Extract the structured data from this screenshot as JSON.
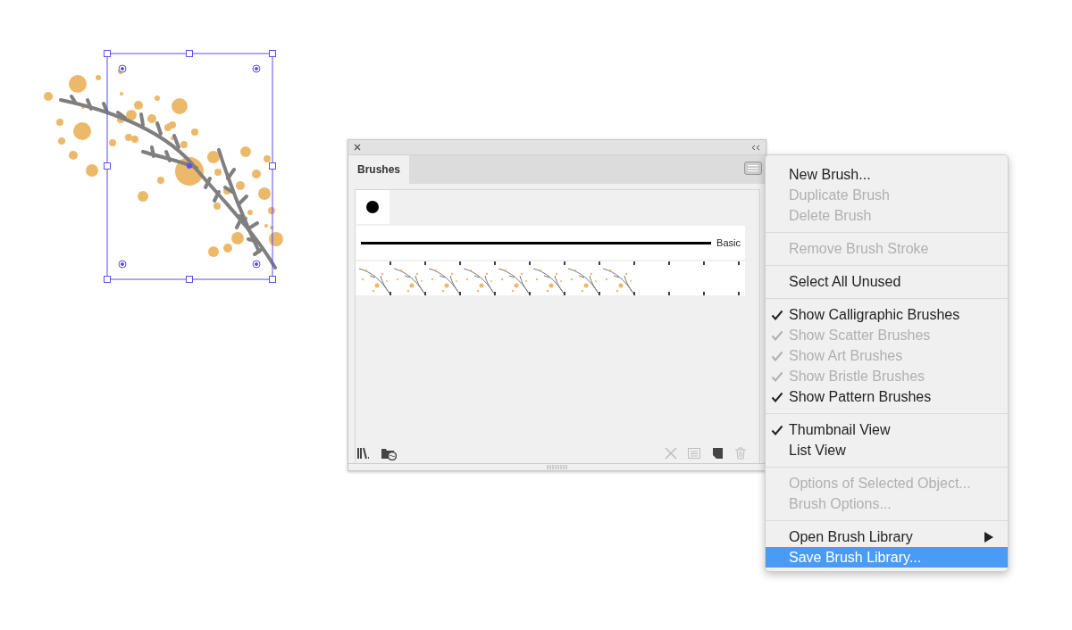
{
  "panel": {
    "tabs": [
      {
        "label": "Brushes",
        "selected": true
      }
    ],
    "brush_rows": [
      {
        "kind": "calligraphic"
      },
      {
        "kind": "stroke",
        "label": "Basic"
      },
      {
        "kind": "pattern"
      }
    ],
    "toolbar": [
      {
        "kind": "libraries",
        "disabled": false
      },
      {
        "kind": "cloud-library",
        "disabled": false
      },
      {
        "kind": "remove-stroke",
        "disabled": true
      },
      {
        "kind": "options",
        "disabled": true
      },
      {
        "kind": "new",
        "disabled": false
      },
      {
        "kind": "delete",
        "disabled": true
      }
    ]
  },
  "menu": {
    "sections": [
      [
        {
          "label": "New Brush...",
          "disabled": false,
          "selected": false
        },
        {
          "label": "Duplicate Brush",
          "disabled": true,
          "selected": false
        },
        {
          "label": "Delete Brush",
          "disabled": true,
          "selected": false
        }
      ],
      [
        {
          "label": "Remove Brush Stroke",
          "disabled": true,
          "selected": false
        }
      ],
      [
        {
          "label": "Select All Unused",
          "disabled": false,
          "selected": false
        }
      ],
      [
        {
          "label": "Show Calligraphic Brushes",
          "disabled": false,
          "checked": true,
          "selected": false
        },
        {
          "label": "Show Scatter Brushes",
          "disabled": true,
          "checked": true,
          "selected": false
        },
        {
          "label": "Show Art Brushes",
          "disabled": true,
          "checked": true,
          "selected": false
        },
        {
          "label": "Show Bristle Brushes",
          "disabled": true,
          "checked": true,
          "selected": false
        },
        {
          "label": "Show Pattern Brushes",
          "disabled": false,
          "checked": true,
          "selected": false
        }
      ],
      [
        {
          "label": "Thumbnail View",
          "disabled": false,
          "checked": true,
          "selected": false
        },
        {
          "label": "List View",
          "disabled": false,
          "checked": false,
          "selected": false
        }
      ],
      [
        {
          "label": "Options of Selected Object...",
          "disabled": true,
          "selected": false
        },
        {
          "label": "Brush Options...",
          "disabled": true,
          "selected": false
        }
      ],
      [
        {
          "label": "Open Brush Library",
          "disabled": false,
          "submenu": true,
          "selected": false
        },
        {
          "label": "Save Brush Library...",
          "disabled": false,
          "selected": true
        }
      ]
    ]
  }
}
